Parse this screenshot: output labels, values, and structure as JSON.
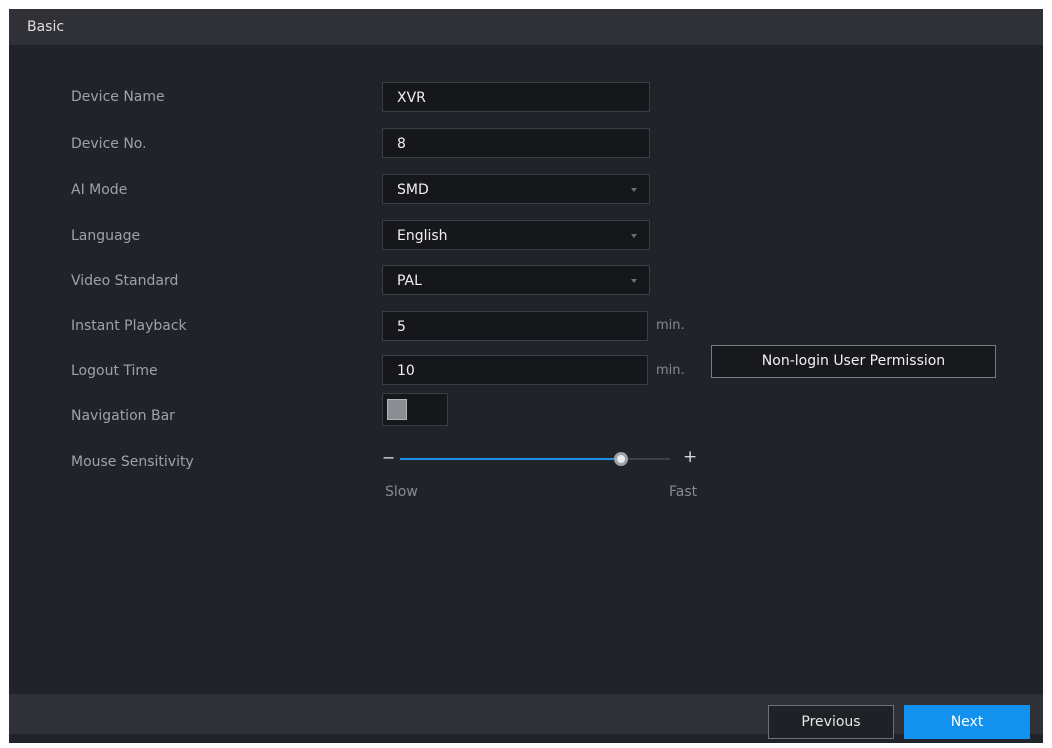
{
  "window": {
    "title": "Basic"
  },
  "fields": {
    "device_name": {
      "label": "Device Name",
      "value": "XVR"
    },
    "device_no": {
      "label": "Device No.",
      "value": "8"
    },
    "ai_mode": {
      "label": "AI Mode",
      "value": "SMD"
    },
    "language": {
      "label": "Language",
      "value": "English"
    },
    "video_standard": {
      "label": "Video Standard",
      "value": "PAL"
    },
    "instant_playback": {
      "label": "Instant Playback",
      "value": "5",
      "unit": "min."
    },
    "logout_time": {
      "label": "Logout Time",
      "value": "10",
      "unit": "min."
    },
    "navigation_bar": {
      "label": "Navigation Bar",
      "enabled": false
    },
    "mouse_sensitivity": {
      "label": "Mouse Sensitivity",
      "minus_symbol": "−",
      "plus_symbol": "+",
      "slow_label": "Slow",
      "fast_label": "Fast",
      "level_fraction": 0.82
    }
  },
  "buttons": {
    "non_login_permission": "Non-login User Permission",
    "previous": "Previous",
    "next": "Next"
  },
  "colors": {
    "accent": "#1291ef",
    "background": "#21232a",
    "bar": "#2f3137"
  }
}
